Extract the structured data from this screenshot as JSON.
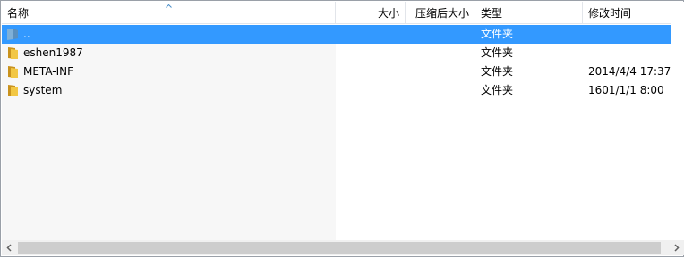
{
  "columns": {
    "name": "名称",
    "size": "大小",
    "packed_size": "压缩后大小",
    "type": "类型",
    "modified": "修改时间"
  },
  "sort_indicator": "chevron-up-icon",
  "rows": [
    {
      "name": "..",
      "size": "",
      "packed_size": "",
      "type": "文件夹",
      "modified": "",
      "selected": true,
      "icon": "folder-up-icon"
    },
    {
      "name": "eshen1987",
      "size": "",
      "packed_size": "",
      "type": "文件夹",
      "modified": "",
      "selected": false,
      "icon": "folder-icon"
    },
    {
      "name": "META-INF",
      "size": "",
      "packed_size": "",
      "type": "文件夹",
      "modified": "2014/4/4 17:37",
      "selected": false,
      "icon": "folder-icon"
    },
    {
      "name": "system",
      "size": "",
      "packed_size": "",
      "type": "文件夹",
      "modified": "1601/1/1 8:00",
      "selected": false,
      "icon": "folder-icon"
    }
  ],
  "colors": {
    "selection": "#3399ff",
    "folder": "#e8b531",
    "scrollbar_thumb": "#cdcdcd"
  }
}
